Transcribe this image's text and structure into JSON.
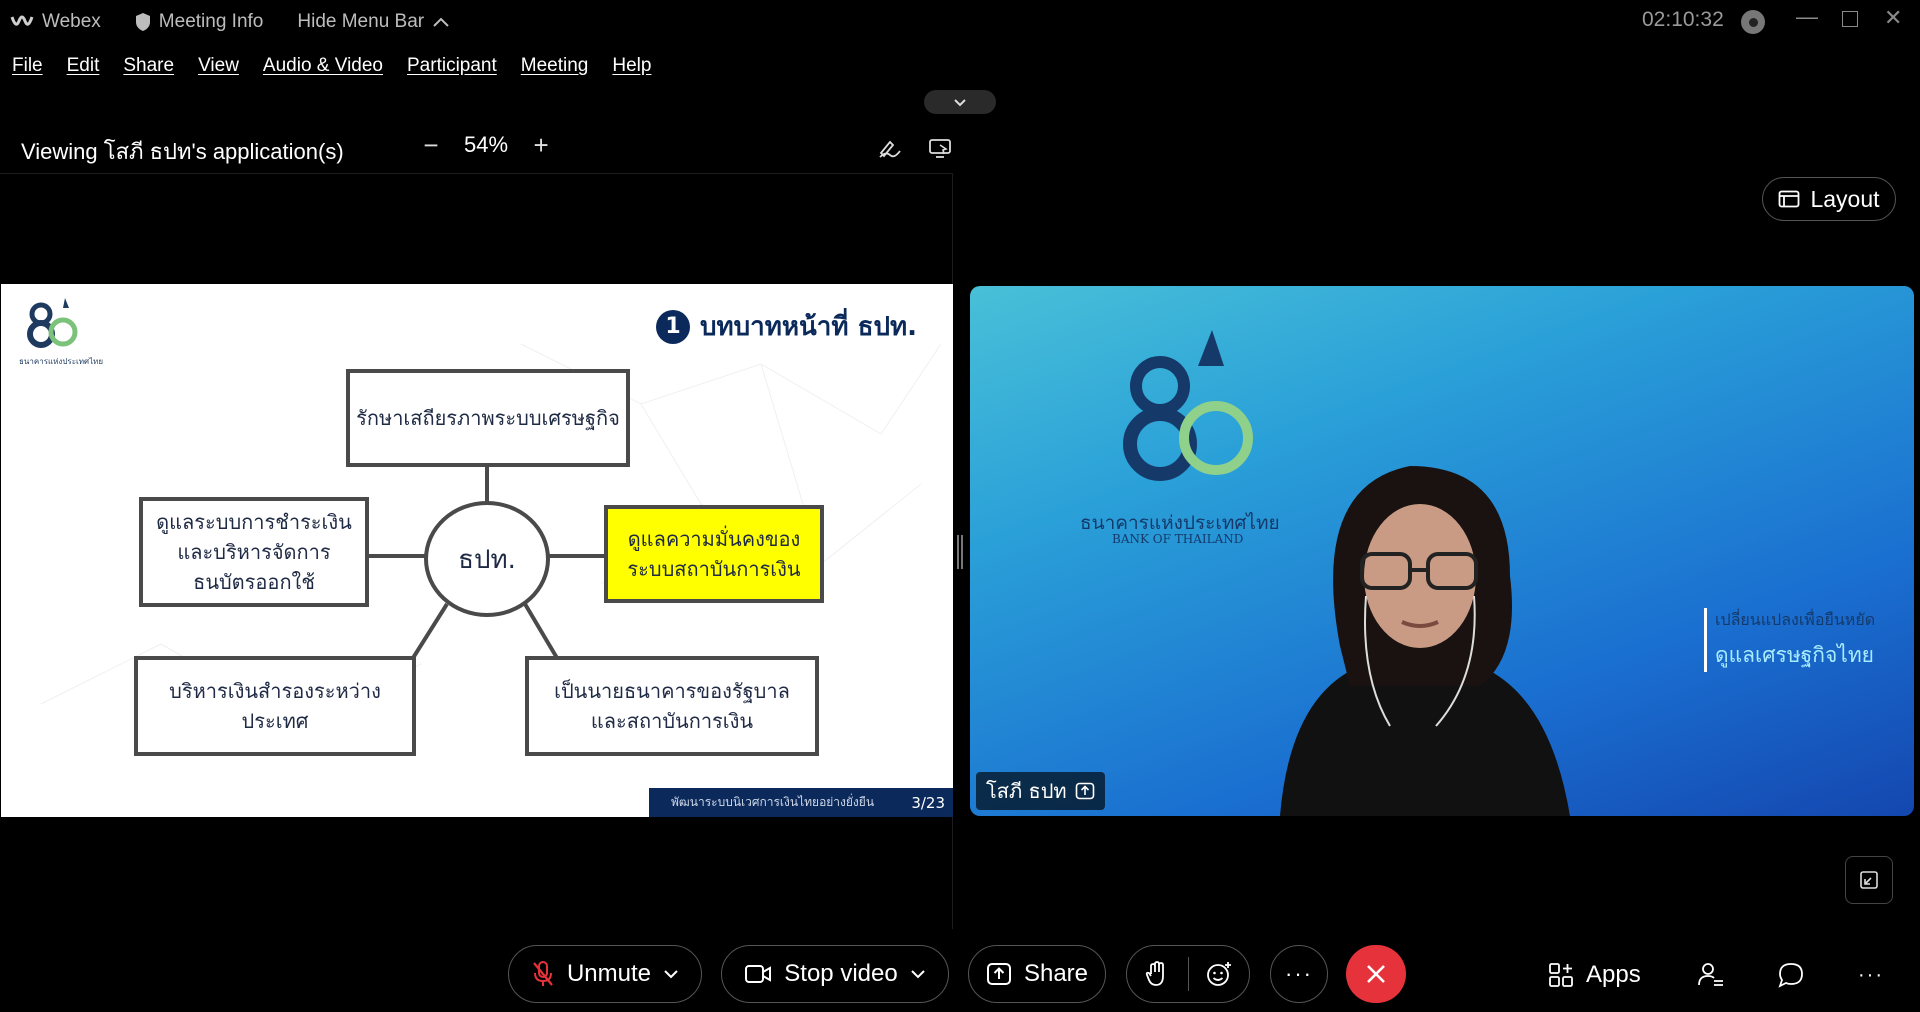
{
  "titlebar": {
    "app": "Webex",
    "meeting_info": "Meeting Info",
    "hide_menu": "Hide Menu Bar",
    "timer": "02:10:32"
  },
  "menu": [
    "File",
    "Edit",
    "Share",
    "View",
    "Audio & Video",
    "Participant",
    "Meeting",
    "Help"
  ],
  "share_header": {
    "viewing": "Viewing โสภี ธปท's application(s)",
    "zoom": "54%"
  },
  "slide": {
    "title": "บทบาทหน้าที่ ธปท.",
    "number": "1",
    "logo_sub": "ธนาคารแห่งประเทศไทย",
    "center": "ธปท.",
    "node_top": "รักษาเสถียรภาพระบบเศรษฐกิจ",
    "node_left_1": "ดูแลระบบการชำระเงิน",
    "node_left_2": "และบริหารจัดการ",
    "node_left_3": "ธนบัตรออกใช้",
    "node_right_1": "ดูแลความมั่นคงของ",
    "node_right_2": "ระบบสถาบันการเงิน",
    "node_bl": "บริหารเงินสำรองระหว่างประเทศ",
    "node_br_1": "เป็นนายธนาคารของรัฐบาล",
    "node_br_2": "และสถาบันการเงิน",
    "footer": "พัฒนาระบบนิเวศการเงินไทยอย่างยั่งยืน",
    "page": "3/23",
    "highlight_color": "#ffff00"
  },
  "layout_btn": "Layout",
  "video": {
    "name": "โสภี ธปท",
    "bg_logo_th": "ธนาคารแห่งประเทศไทย",
    "bg_logo_en": "BANK OF THAILAND",
    "bg_slogan_1": "เปลี่ยนแปลงเพื่อยืนหยัด",
    "bg_slogan_2": "ดูแลเศรษฐกิจไทย"
  },
  "toolbar": {
    "unmute": "Unmute",
    "stop_video": "Stop video",
    "share": "Share",
    "apps": "Apps",
    "end_color": "#e6323b"
  }
}
